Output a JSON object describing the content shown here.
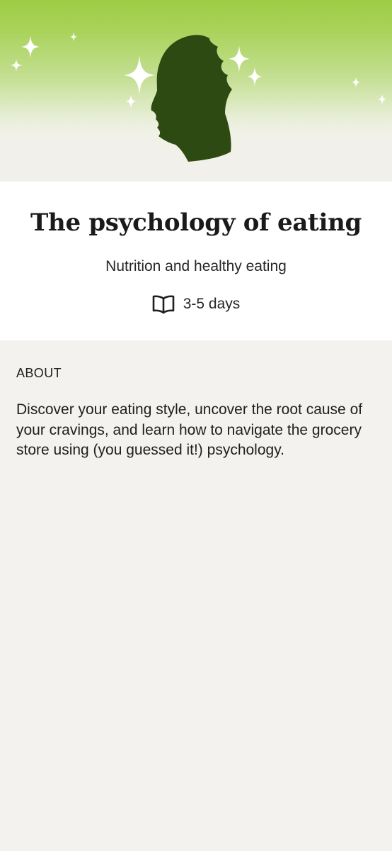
{
  "course": {
    "title": "The psychology of eating",
    "category": "Nutrition and healthy eating",
    "duration_icon": "open-book-icon",
    "duration": "3-5 days"
  },
  "about": {
    "heading": "ABOUT",
    "description": "Discover your eating style, uncover the root cause of your cravings, and learn how to navigate the grocery store using (you guessed it!) psychology."
  },
  "hero": {
    "illustration": "head-silhouette-with-bite-and-sparkles",
    "colors": {
      "gradient_top": "#9dcd45",
      "gradient_bottom": "#f1f0ea",
      "silhouette": "#2c4a12",
      "sparkle": "#ffffff"
    }
  }
}
